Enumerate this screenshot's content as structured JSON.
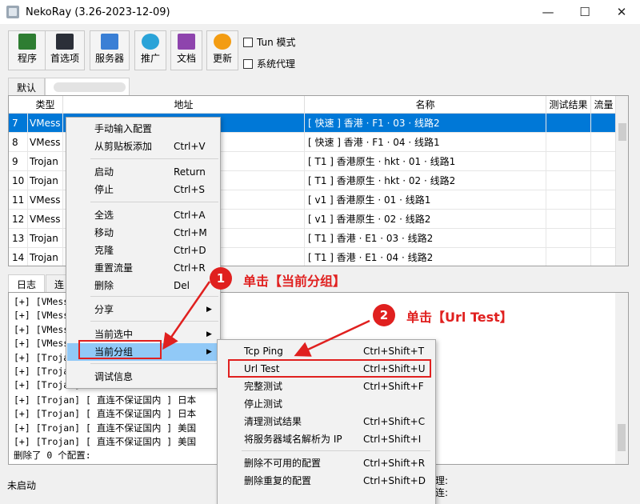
{
  "window": {
    "title": "NekoRay (3.26-2023-12-09)",
    "min": "—",
    "max": "☐",
    "close": "✕"
  },
  "toolbar": {
    "buttons": [
      {
        "label": "程序",
        "icon": "terminal-icon"
      },
      {
        "label": "首选项",
        "icon": "settings-icon"
      },
      {
        "label": "服务器",
        "icon": "server-icon"
      },
      {
        "label": "推广",
        "icon": "globe-icon"
      },
      {
        "label": "文档",
        "icon": "question-icon"
      },
      {
        "label": "更新",
        "icon": "update-icon"
      }
    ],
    "tun_label": "Tun 模式",
    "proxy_label": "系统代理"
  },
  "group_tabs": {
    "default": "默认"
  },
  "table": {
    "headers": [
      "类型",
      "地址",
      "名称",
      "测试结果",
      "流量"
    ],
    "rows": [
      {
        "num": "7",
        "type": "VMess",
        "name": "[ 快速 ] 香港 · F1 · 03 · 线路2",
        "selected": true
      },
      {
        "num": "8",
        "type": "VMess",
        "name": "[ 快速 ] 香港 · F1 · 04 · 线路1",
        "selected": false
      },
      {
        "num": "9",
        "type": "Trojan",
        "name": "[ T1 ] 香港原生 · hkt · 01 · 线路1",
        "selected": false
      },
      {
        "num": "10",
        "type": "Trojan",
        "name": "[ T1 ] 香港原生 · hkt  · 02 · 线路2",
        "selected": false
      },
      {
        "num": "11",
        "type": "VMess",
        "name": "[ v1 ] 香港原生 · 01 · 线路1",
        "selected": false
      },
      {
        "num": "12",
        "type": "VMess",
        "name": "[ v1 ] 香港原生 · 02 · 线路2",
        "selected": false
      },
      {
        "num": "13",
        "type": "Trojan",
        "name": "[ T1 ] 香港 · E1 · 03 · 线路2",
        "selected": false
      },
      {
        "num": "14",
        "type": "Trojan",
        "name": "[ T1 ] 香港 · E1 · 04 · 线路2",
        "selected": false
      }
    ]
  },
  "bottom_tabs": {
    "log": "日志",
    "conn": "连"
  },
  "log": {
    "lines": [
      "[+] [VMess",
      "[+] [VMess",
      "[+] [VMess",
      "[+] [VMess",
      "[+] [Trojan",
      "[+] [Trojan",
      "[+] [Trojan]",
      "[+] [Trojan] [ 直连不保证国内 ] 日本",
      "[+] [Trojan] [ 直连不保证国内 ] 日本",
      "[+] [Trojan] [ 直连不保证国内 ] 美国",
      "[+] [Trojan] [ 直连不保证国内 ] 美国",
      "删除了 0 个配置:"
    ]
  },
  "status": {
    "text": "未启动",
    "right1": "理:",
    "right2": "连:"
  },
  "context_menu": {
    "items": [
      {
        "label": "手动输入配置",
        "shortcut": ""
      },
      {
        "label": "从剪贴板添加",
        "shortcut": "Ctrl+V"
      },
      {
        "label": "启动",
        "shortcut": "Return"
      },
      {
        "label": "停止",
        "shortcut": "Ctrl+S"
      },
      {
        "label": "全选",
        "shortcut": "Ctrl+A"
      },
      {
        "label": "移动",
        "shortcut": "Ctrl+M"
      },
      {
        "label": "克隆",
        "shortcut": "Ctrl+D"
      },
      {
        "label": "重置流量",
        "shortcut": "Ctrl+R"
      },
      {
        "label": "删除",
        "shortcut": "Del"
      },
      {
        "label": "分享",
        "shortcut": ""
      },
      {
        "label": "当前选中",
        "shortcut": ""
      },
      {
        "label": "当前分组",
        "shortcut": ""
      },
      {
        "label": "调试信息",
        "shortcut": ""
      }
    ]
  },
  "submenu": {
    "items": [
      {
        "label": "Tcp Ping",
        "shortcut": "Ctrl+Shift+T"
      },
      {
        "label": "Url Test",
        "shortcut": "Ctrl+Shift+U"
      },
      {
        "label": "完整测试",
        "shortcut": "Ctrl+Shift+F"
      },
      {
        "label": "停止测试",
        "shortcut": ""
      },
      {
        "label": "清理测试结果",
        "shortcut": "Ctrl+Shift+C"
      },
      {
        "label": "将服务器域名解析为 IP",
        "shortcut": "Ctrl+Shift+I"
      },
      {
        "label": "删除不可用的配置",
        "shortcut": "Ctrl+Shift+R"
      },
      {
        "label": "删除重复的配置",
        "shortcut": "Ctrl+Shift+D"
      }
    ]
  },
  "annotations": {
    "step1": {
      "num": "1",
      "text": "单击【当前分组】"
    },
    "step2": {
      "num": "2",
      "text": "单击【Url Test】"
    }
  },
  "colors": {
    "selection": "#0078d7",
    "highlight": "#91c9f7",
    "annotation": "#e0201f"
  }
}
